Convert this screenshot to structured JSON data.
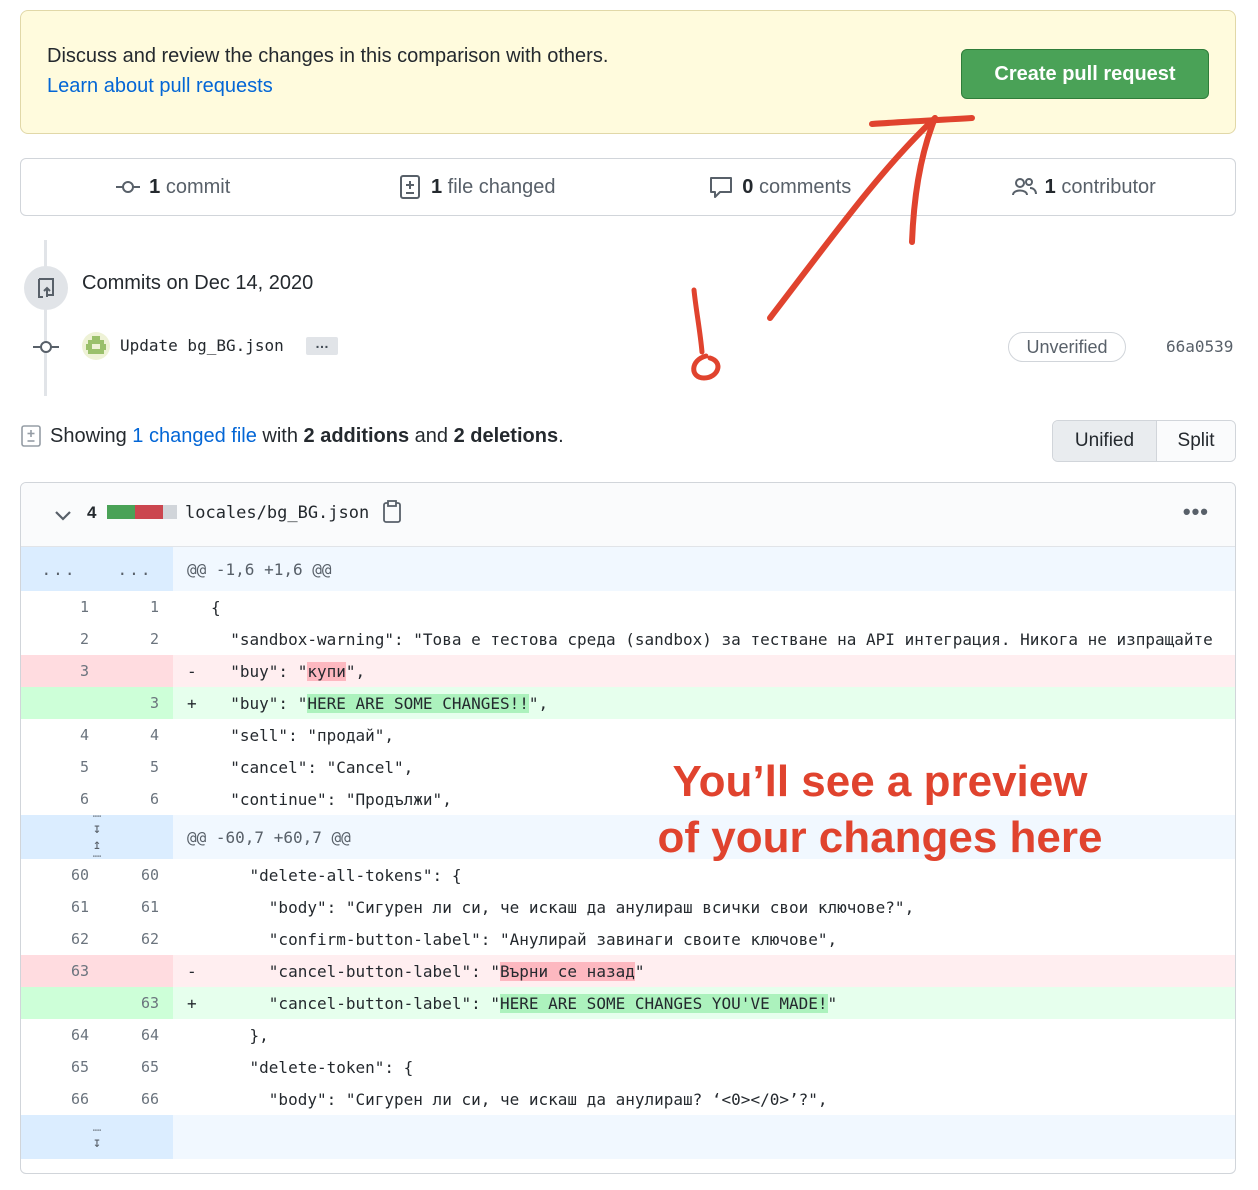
{
  "banner": {
    "text": "Discuss and review the changes in this comparison with others.",
    "link": "Learn about pull requests",
    "button": "Create pull request"
  },
  "stats": {
    "commit_count": "1",
    "commit_label": "commit",
    "files_count": "1",
    "files_label": "file changed",
    "comments_count": "0",
    "comments_label": "comments",
    "contrib_count": "1",
    "contrib_label": "contributor"
  },
  "timeline": {
    "date": "Commits on Dec 14, 2020",
    "commit_message": "Update bg_BG.json",
    "more": "…",
    "badge": "Unverified",
    "sha": "66a0539"
  },
  "summary": {
    "prefix": "Showing",
    "link": "1 changed file",
    "mid": "with",
    "additions": "2 additions",
    "and": "and",
    "deletions": "2 deletions",
    "end": "."
  },
  "view_toggle": {
    "unified": "Unified",
    "split": "Split"
  },
  "file": {
    "change_count": "4",
    "name": "locales/bg_BG.json",
    "more": "•••",
    "hunk1": "@@ -1,6 +1,6 @@",
    "hunk2": "@@ -60,7 +60,7 @@",
    "hunk_dots": "...",
    "lines": [
      {
        "old": "1",
        "new": "1",
        "sign": " ",
        "code": "{"
      },
      {
        "old": "2",
        "new": "2",
        "sign": " ",
        "code": "  \"sandbox-warning\": \"Това е тестова среда (sandbox) за тестване на API интеграция. Никога не изпращайте"
      },
      {
        "old": "3",
        "new": "",
        "sign": "-",
        "pre": "  \"buy\": \"",
        "hl": "купи",
        "post": "\","
      },
      {
        "old": "",
        "new": "3",
        "sign": "+",
        "pre": "  \"buy\": \"",
        "hl": "HERE ARE SOME CHANGES!!",
        "post": "\","
      },
      {
        "old": "4",
        "new": "4",
        "sign": " ",
        "code": "  \"sell\": \"продай\","
      },
      {
        "old": "5",
        "new": "5",
        "sign": " ",
        "code": "  \"cancel\": \"Cancel\","
      },
      {
        "old": "6",
        "new": "6",
        "sign": " ",
        "code": "  \"continue\": \"Продължи\","
      }
    ],
    "lines2": [
      {
        "old": "60",
        "new": "60",
        "sign": " ",
        "code": "    \"delete-all-tokens\": {"
      },
      {
        "old": "61",
        "new": "61",
        "sign": " ",
        "code": "      \"body\": \"Сигурен ли си, че искаш да анулираш всички свои ключове?\","
      },
      {
        "old": "62",
        "new": "62",
        "sign": " ",
        "code": "      \"confirm-button-label\": \"Анулирай завинаги своите ключове\","
      },
      {
        "old": "63",
        "new": "",
        "sign": "-",
        "pre": "      \"cancel-button-label\": \"",
        "hl": "Върни се назад",
        "post": "\""
      },
      {
        "old": "",
        "new": "63",
        "sign": "+",
        "pre": "      \"cancel-button-label\": \"",
        "hl": "HERE ARE SOME CHANGES YOU'VE MADE!",
        "post": "\""
      },
      {
        "old": "64",
        "new": "64",
        "sign": " ",
        "code": "    },"
      },
      {
        "old": "65",
        "new": "65",
        "sign": " ",
        "code": "    \"delete-token\": {"
      },
      {
        "old": "66",
        "new": "66",
        "sign": " ",
        "code": "      \"body\": \"Сигурен ли си, че искаш да анулираш? ‘<0></0>’?\","
      }
    ]
  },
  "annotation": {
    "line1": "You’ll see a preview",
    "line2": "of your changes here"
  },
  "colors": {
    "accent_green": "#4aa257",
    "link_blue": "#0366d6",
    "annotation_red": "#e0432e"
  }
}
